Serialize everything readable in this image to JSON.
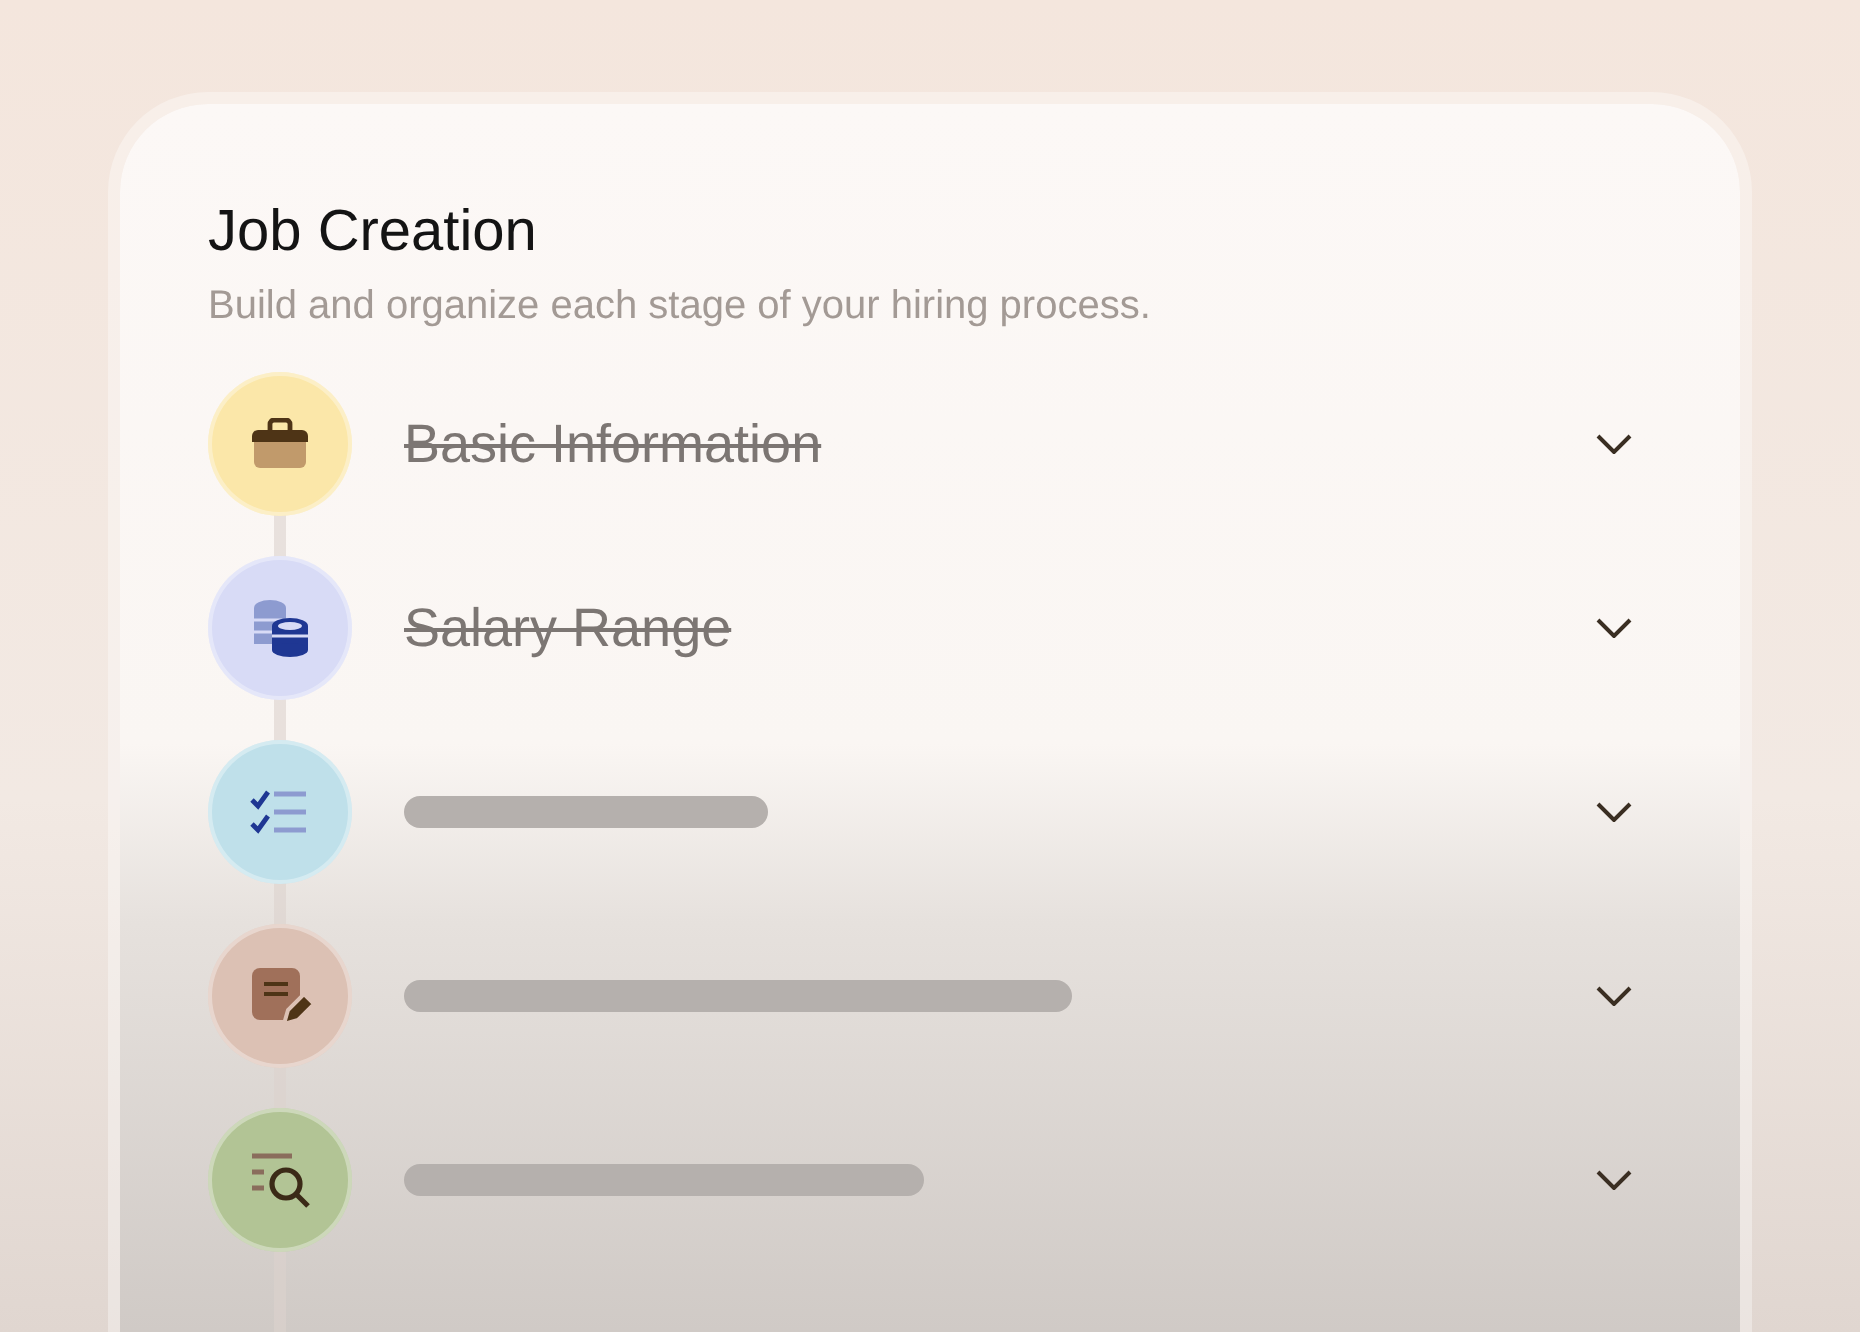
{
  "card": {
    "title": "Job Creation",
    "subtitle": "Build and organize each stage of your hiring process."
  },
  "steps": [
    {
      "kind": "text",
      "color": "#fbe7a9",
      "label": "Basic Information",
      "completed": true
    },
    {
      "kind": "text",
      "color": "#d8dbf6",
      "label": "Salary Range",
      "completed": true
    },
    {
      "kind": "placeholder",
      "color": "#bfe0ea"
    },
    {
      "kind": "placeholder",
      "color": "#dcc1b4"
    },
    {
      "kind": "placeholder",
      "color": "#b2c495"
    }
  ]
}
